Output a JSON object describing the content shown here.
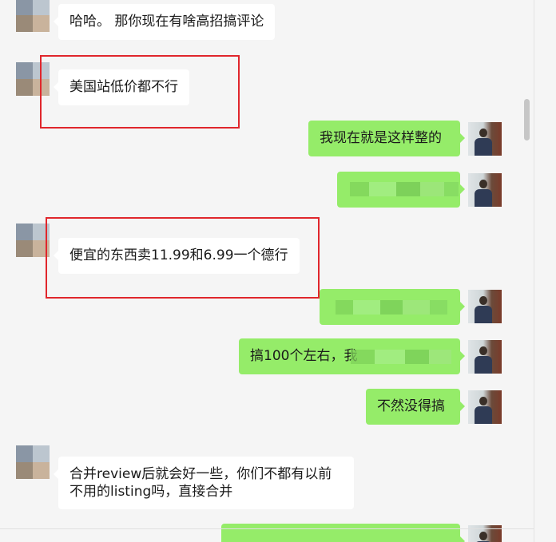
{
  "colors": {
    "self_bubble": "#95ec69",
    "other_bubble": "#ffffff",
    "highlight": "#e0262c",
    "background": "#f5f5f5"
  },
  "messages": [
    {
      "side": "left",
      "text": "哈哈。 那你现在有啥高招搞评论"
    },
    {
      "side": "left",
      "text": "美国站低价都不行"
    },
    {
      "side": "right",
      "text": "我现在就是这样整的"
    },
    {
      "side": "right",
      "text": ""
    },
    {
      "side": "left",
      "text": "便宜的东西卖11.99和6.99一个德行"
    },
    {
      "side": "right",
      "text": ""
    },
    {
      "side": "right",
      "text": "搞100个左右，我"
    },
    {
      "side": "right",
      "text": "不然没得搞"
    },
    {
      "side": "left",
      "text": "合并review后就会好一些，你们不都有以前不用的listing吗，直接合并"
    },
    {
      "side": "right",
      "text": ""
    }
  ]
}
